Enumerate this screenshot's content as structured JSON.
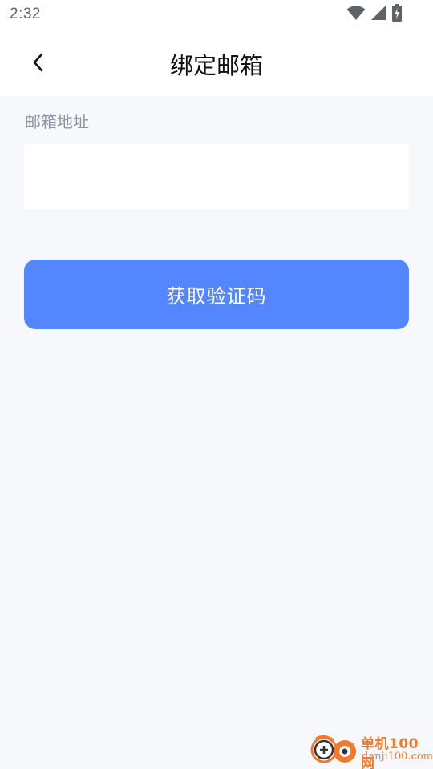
{
  "status_bar": {
    "time": "2:32",
    "icons": [
      "wifi-icon",
      "cellular-signal-icon",
      "battery-charging-icon"
    ]
  },
  "header": {
    "title": "绑定邮箱",
    "back_icon": "chevron-left-icon"
  },
  "form": {
    "email_label": "邮箱地址",
    "email_value": "",
    "email_placeholder": "",
    "submit_label": "获取验证码"
  },
  "watermark": {
    "name": "单机100网",
    "domain": "danji100.com"
  },
  "colors": {
    "accent": "#5486ff",
    "background": "#f6f8fc",
    "label": "#8c93a5",
    "watermark": "#f27a2a"
  }
}
